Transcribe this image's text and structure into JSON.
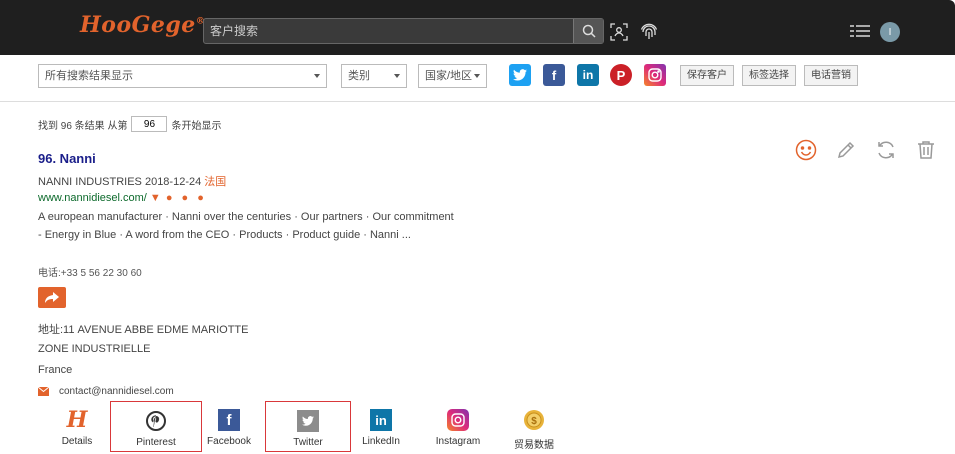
{
  "header": {
    "logo": "HooGege",
    "logo_mark": "®",
    "search_placeholder": "客户搜索",
    "avatar_initial": "I"
  },
  "filters": {
    "scope_select": "所有搜索结果显示",
    "type_select": "类别",
    "region_select": "国家/地区",
    "social": [
      "twitter",
      "facebook",
      "linkedin",
      "pinterest",
      "instagram"
    ],
    "buttons": [
      "保存客户",
      "标签选择",
      "电话营销"
    ]
  },
  "meta": {
    "prefix": "找到 96 条结果  从第",
    "start_value": "96",
    "suffix": "条开始显示"
  },
  "result": {
    "title": "96. Nanni",
    "company_line": "NANNI INDUSTRIES 2018-12-24 ",
    "country": "法国",
    "url": "www.nannidiesel.com/",
    "url_marker": "▼",
    "dots": "● ● ●",
    "description": "A european manufacturer · Nanni over the centuries · Our partners · Our commitment - Energy in Blue · A word from the CEO · Products · Product guide · Nanni ...",
    "phone": "电话:+33 5 56 22 30 60",
    "address_line1": "地址:11 AVENUE ABBE EDME MARIOTTE",
    "address_line2": "ZONE INDUSTRIELLE",
    "address_line3": "France",
    "email": "contact@nannidiesel.com"
  },
  "tabs": [
    {
      "label": "Details",
      "icon": "hoogege-h-icon",
      "color": "#e2632c"
    },
    {
      "label": "Pinterest",
      "icon": "pinterest-icon",
      "color": "#333333"
    },
    {
      "label": "Facebook",
      "icon": "facebook-icon",
      "color": "#3b5998"
    },
    {
      "label": "Twitter",
      "icon": "twitter-icon",
      "color": "#8c8c8c"
    },
    {
      "label": "LinkedIn",
      "icon": "linkedin-icon",
      "color": "#0e76a8"
    },
    {
      "label": "Instagram",
      "icon": "instagram-icon",
      "color": "#c13584"
    },
    {
      "label": "贸易数据",
      "icon": "trade-coin-icon",
      "color": "#e8b33a"
    }
  ],
  "colors": {
    "accent": "#e2632c",
    "topbar": "#1f1f1f",
    "title_link": "#1a1e8a",
    "url_green": "#0d6a2c",
    "highlight_box": "#d9383a"
  }
}
